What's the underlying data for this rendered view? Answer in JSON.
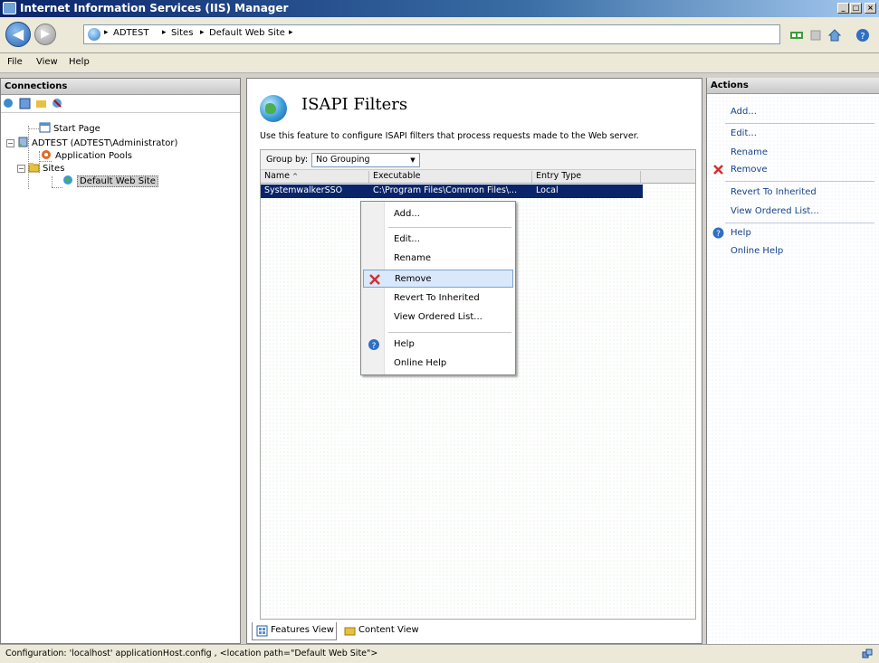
{
  "window": {
    "title": "Internet Information Services (IIS) Manager",
    "controls": [
      "_",
      "□",
      "×"
    ]
  },
  "address": {
    "crumbs": [
      "ADTEST",
      "Sites",
      "Default Web Site"
    ],
    "separator": "▸"
  },
  "menu": {
    "items": [
      "File",
      "View",
      "Help"
    ]
  },
  "connections": {
    "title": "Connections",
    "tree": {
      "start_page": "Start Page",
      "server": "ADTEST (ADTEST\\Administrator)",
      "app_pools": "Application Pools",
      "sites": "Sites",
      "default_site": "Default Web Site"
    }
  },
  "main": {
    "title": "ISAPI Filters",
    "description": "Use this feature to configure ISAPI filters that process requests made to the Web server.",
    "group_by_label": "Group by:",
    "group_by_value": "No Grouping",
    "columns": [
      "Name",
      "Executable",
      "Entry Type"
    ],
    "sort_indicator": "^",
    "rows": [
      {
        "name": "SystemwalkerSSO",
        "executable": "C:\\Program Files\\Common Files\\...",
        "entry_type": "Local"
      }
    ]
  },
  "context_menu": {
    "items": [
      "Add...",
      "Edit...",
      "Rename",
      "Remove",
      "Revert To Inherited",
      "View Ordered List...",
      "Help",
      "Online Help"
    ],
    "highlighted": "Remove"
  },
  "view_tabs": {
    "features": "Features View",
    "content": "Content View"
  },
  "actions": {
    "title": "Actions",
    "items": [
      "Add...",
      "Edit...",
      "Rename",
      "Remove",
      "Revert To Inherited",
      "View Ordered List...",
      "Help",
      "Online Help"
    ]
  },
  "status": {
    "text": "Configuration: 'localhost' applicationHost.config , <location path=\"Default Web Site\">"
  },
  "colors": {
    "selection": "#0a246a",
    "link": "#15428b",
    "remove_x": "#d32f2f",
    "menu_highlight": "#d9e8fb"
  }
}
